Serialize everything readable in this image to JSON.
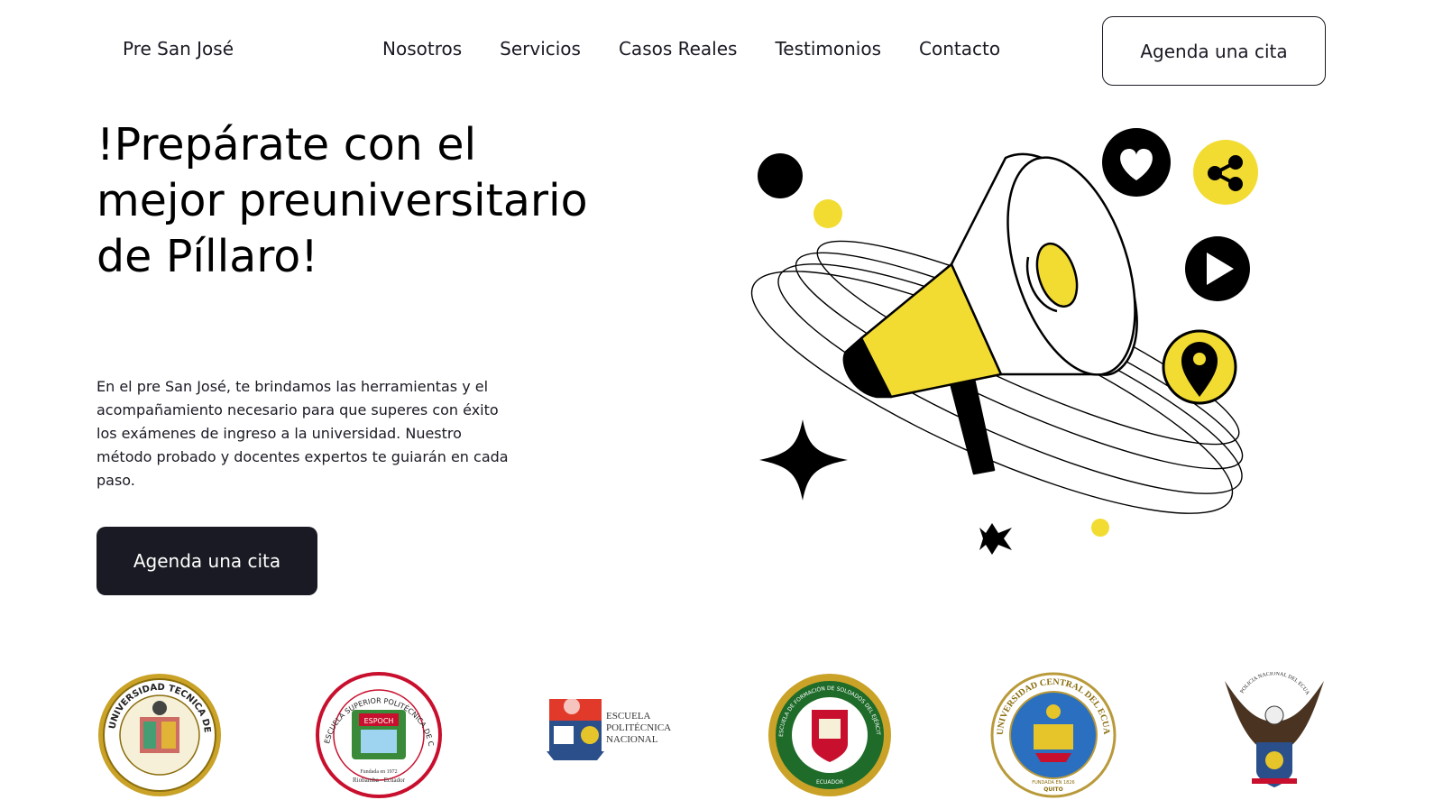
{
  "nav": {
    "brand": "Pre San José",
    "links": [
      "Nosotros",
      "Servicios",
      "Casos Reales",
      "Testimonios",
      "Contacto"
    ],
    "cta_label": "Agenda una cita"
  },
  "hero": {
    "title": "!Prepárate con el mejor preuniversitario de Píllaro!",
    "description": "En el pre San José, te brindamos las herramientas y el acompañamiento necesario para que superes con éxito los exámenes de ingreso a la universidad. Nuestro método probado y docentes expertos te guiarán en cada paso.",
    "cta_label": "Agenda una cita"
  },
  "illustration": {
    "icons": [
      "megaphone-icon",
      "heart-icon",
      "share-icon",
      "play-icon",
      "location-pin-icon",
      "sparkle-star-icon"
    ],
    "colors": {
      "accent_yellow": "#f2dc32",
      "ink": "#000000"
    }
  },
  "logos": [
    {
      "name": "Universidad Técnica de Ambato",
      "text": "UNIVERSIDAD TECNICA DE AMBATO"
    },
    {
      "name": "Escuela Superior Politécnica de Chimborazo",
      "text": "ESCUELA SUPERIOR POLITÉCNICA DE CHIMBORAZO",
      "founded": "Fundada en 1972",
      "location": "Riobamba - Ecuador",
      "badge": "ESPOCH"
    },
    {
      "name": "Escuela Politécnica Nacional",
      "lines": [
        "ESCUELA",
        "POLITÉCNICA",
        "NACIONAL"
      ]
    },
    {
      "name": "Escuela de Formación de Soldados del Ejército",
      "text": "ESCUELA DE FORMACIÓN DE SOLDADOS DEL EJÉRCITO",
      "country": "ECUADOR"
    },
    {
      "name": "Universidad Central del Ecuador",
      "text": "UNIVERSIDAD CENTRAL DEL ECUADOR",
      "founded": "FUNDADA EN 1826",
      "city": "QUITO"
    },
    {
      "name": "Policía Nacional del Ecuador",
      "text": "POLICIA NACIONAL DEL ECUADOR"
    }
  ],
  "colors": {
    "dark": "#191a23",
    "background": "#ffffff",
    "accent": "#f2dc32"
  }
}
